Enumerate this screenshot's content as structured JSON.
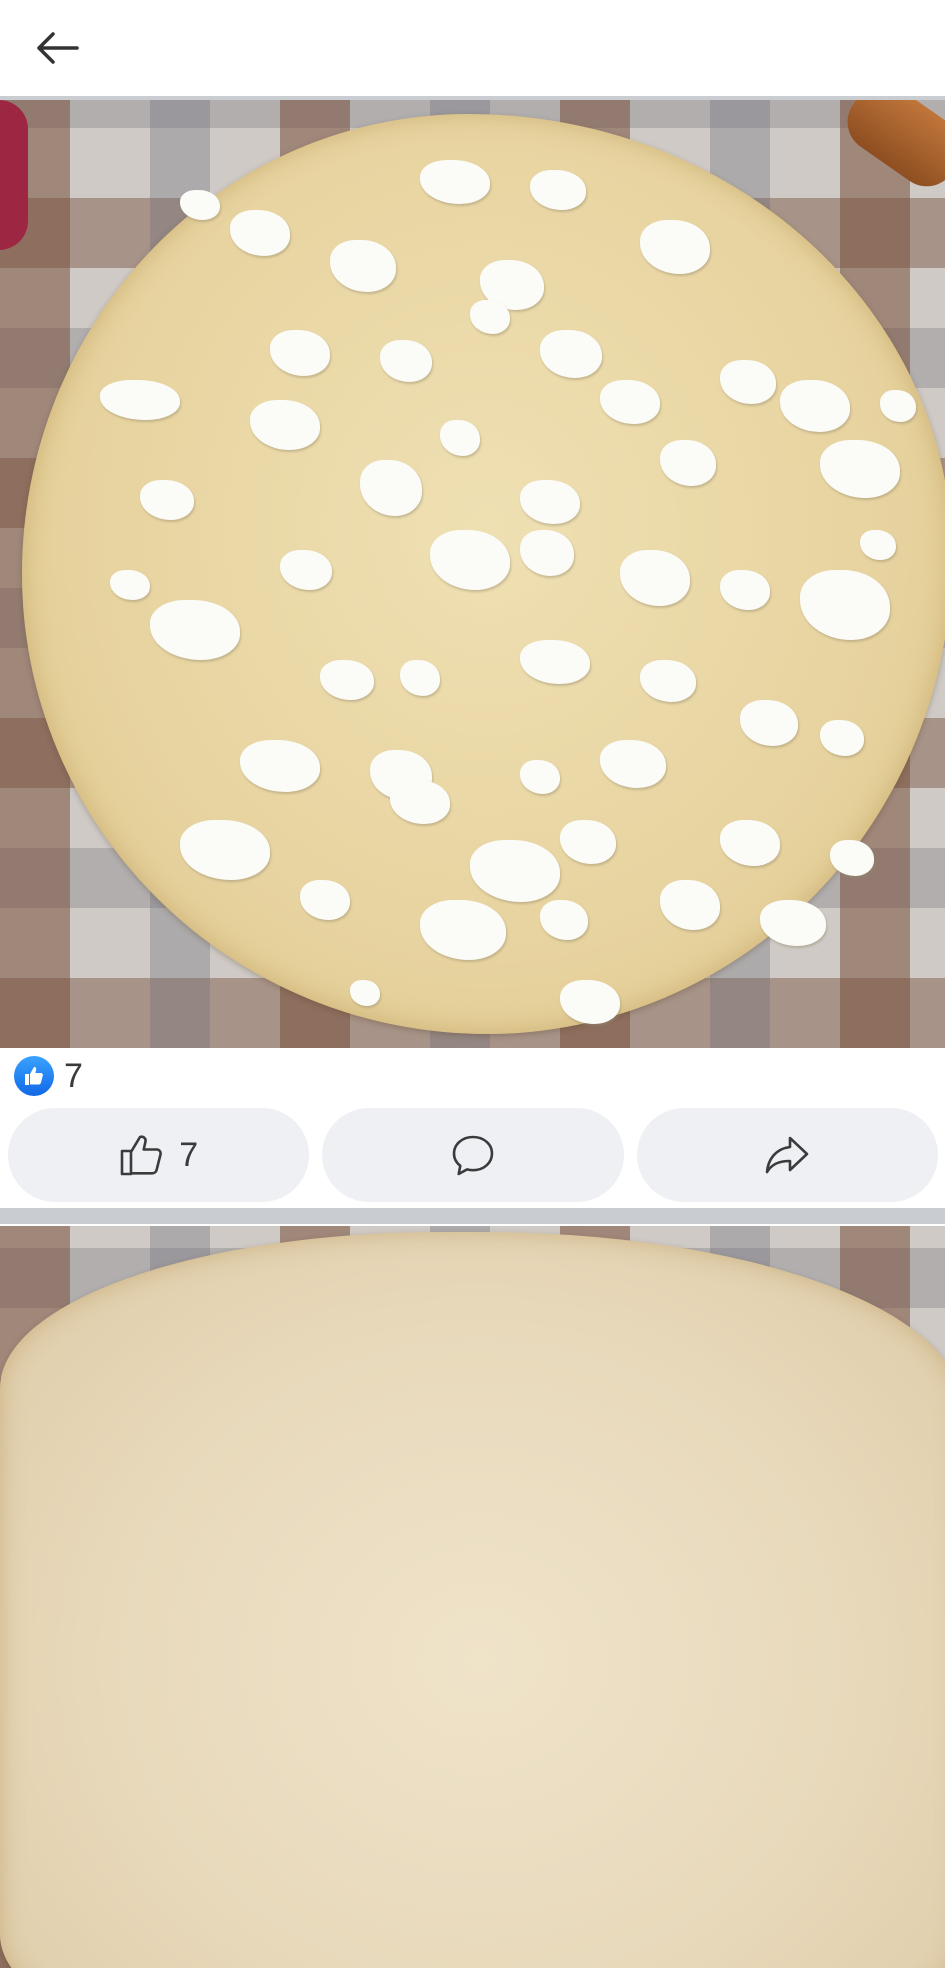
{
  "header": {
    "back_icon": "arrow-left-icon"
  },
  "post": {
    "reaction_icon": "like-icon",
    "reaction_count": "7",
    "actions": {
      "like": {
        "icon": "thumbs-up-icon",
        "count": "7"
      },
      "comment": {
        "icon": "comment-icon"
      },
      "share": {
        "icon": "share-arrow-icon"
      }
    }
  },
  "colors": {
    "accent_blue": "#1877f2",
    "button_bg": "#eef0f3",
    "divider": "#c9ccd1",
    "text": "#3a3b3c"
  }
}
